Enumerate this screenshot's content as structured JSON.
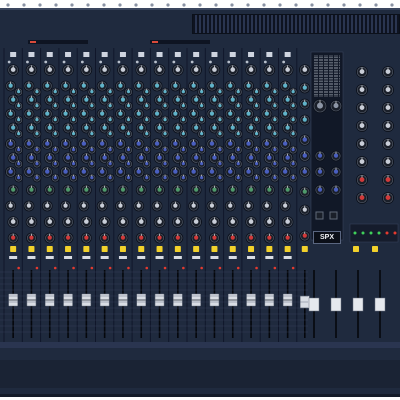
{
  "image": {
    "subject": "mixer-console",
    "colors": {
      "panel": "#1f2a3e",
      "strip_divider": "#10162a",
      "knob_cyan": "#5fb3c9",
      "knob_blue": "#4a5fc0",
      "knob_green": "#4f9a6b",
      "knob_red": "#d23a3a",
      "knob_grey": "#c9ced8",
      "button_yellow": "#f2d12b",
      "led_red": "#e43a2f",
      "fader_cap": "#d9dde4"
    },
    "mono_channels": 16,
    "stereo_channels": 4,
    "logo_text": "SPX"
  }
}
